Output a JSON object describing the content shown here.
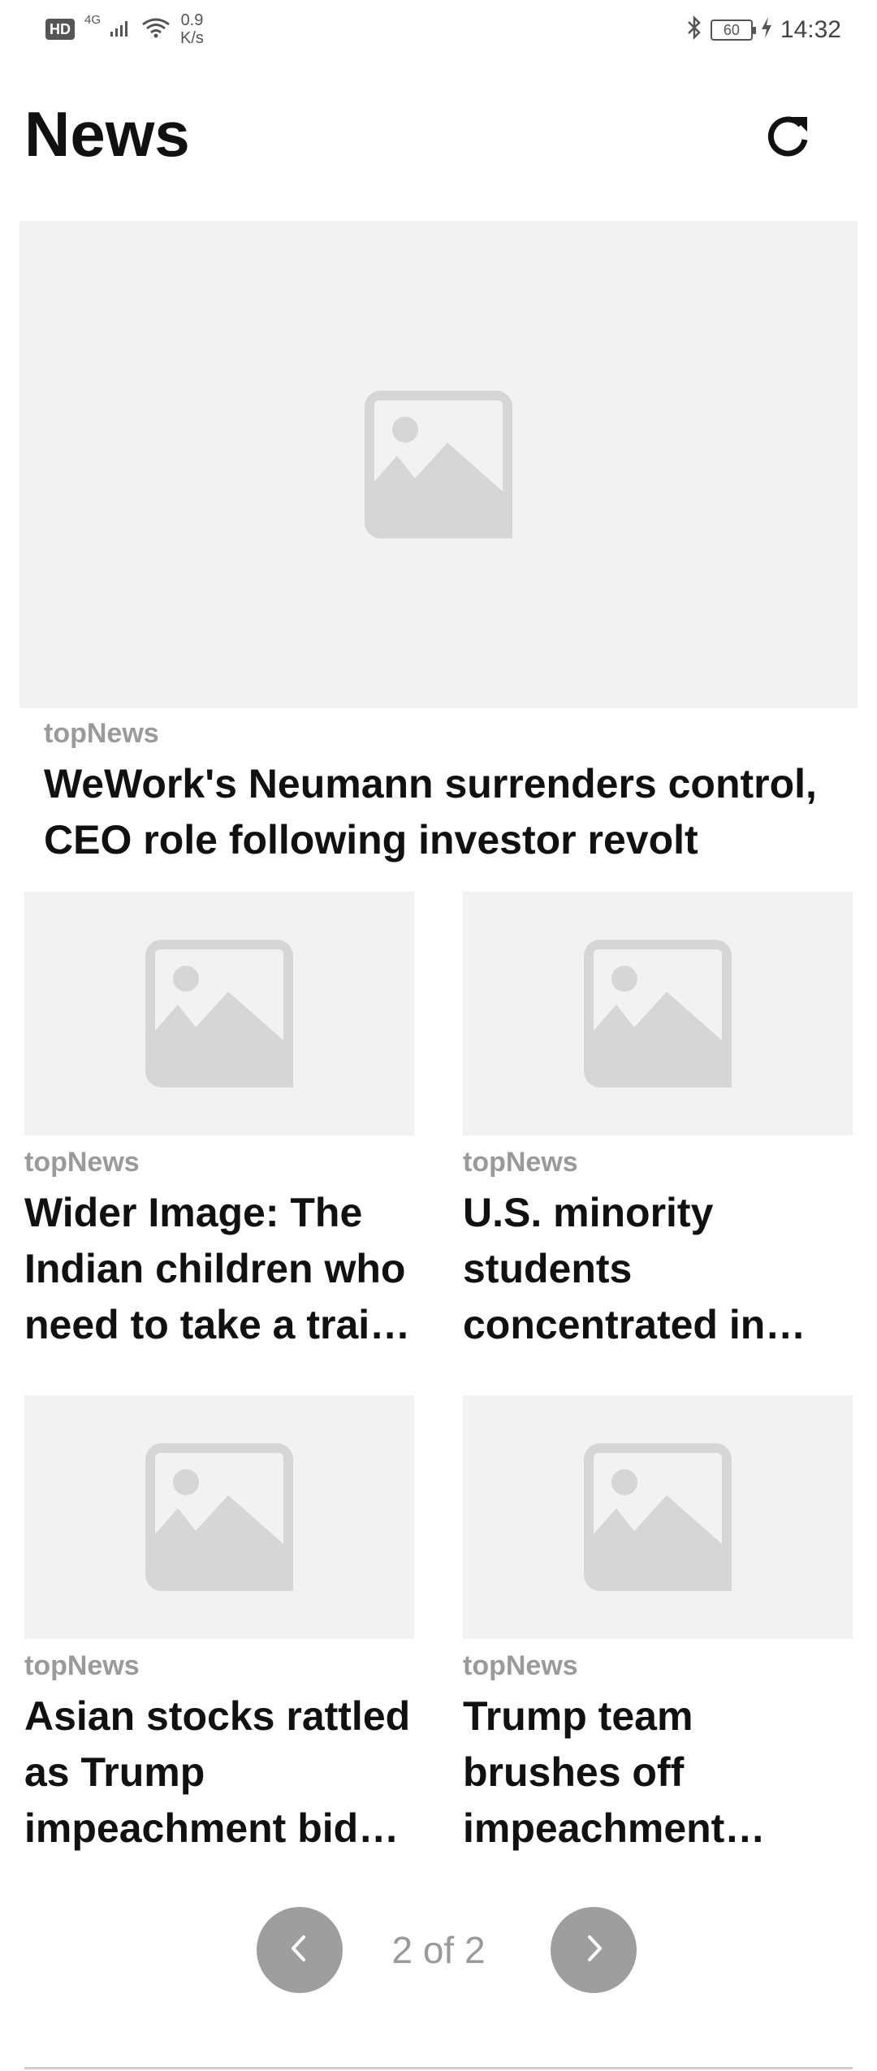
{
  "status_bar": {
    "hd": "HD",
    "network": "4G",
    "speed_value": "0.9",
    "speed_unit": "K/s",
    "battery": "60",
    "time": "14:32"
  },
  "header": {
    "title": "News",
    "refresh_icon": "refresh-icon"
  },
  "featured": {
    "source": "topNews",
    "headline": "WeWork's Neumann surrenders control, CEO role following investor revolt"
  },
  "articles": [
    {
      "source": "topNews",
      "headline": "Wider Image: The Indian children who need to take a train to school"
    },
    {
      "source": "topNews",
      "headline": "U.S. minority students concentrated in high-poverty schools"
    },
    {
      "source": "topNews",
      "headline": "Asian stocks rattled as Trump impeachment bid widens"
    },
    {
      "source": "topNews",
      "headline": "Trump team brushes off impeachment inquiry, raises cash"
    }
  ],
  "pagination": {
    "label": "2 of 2",
    "prev_icon": "chevron-left-icon",
    "next_icon": "chevron-right-icon"
  },
  "colors": {
    "placeholder_bg": "#f2f2f2",
    "placeholder_icon": "#d6d6d6",
    "source_text": "#9a9a9a",
    "pager_button": "#9e9e9e"
  }
}
